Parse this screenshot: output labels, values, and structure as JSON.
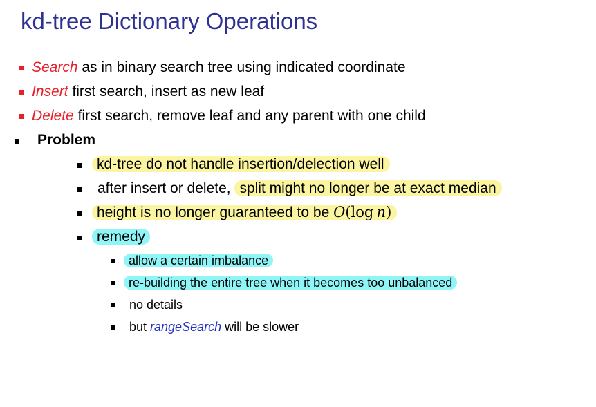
{
  "slide": {
    "title": "kd-tree Dictionary Operations",
    "ops": [
      {
        "keyword": "Search",
        "text": " as in binary search tree using indicated  coordinate"
      },
      {
        "keyword": "Insert",
        "text": " first search, insert as new leaf"
      },
      {
        "keyword": "Delete",
        "text": " first search, remove leaf and  any parent with one child"
      }
    ],
    "problem": {
      "label": "Problem",
      "items": {
        "i1": "kd-tree do not handle insertion/delection well",
        "i2_plain": "after insert or delete, ",
        "i2_highlight": "split might no longer be at exact  median",
        "i3_text": "height is no longer guaranteed to be ",
        "i3_math_o": "O",
        "i3_math_open": "(",
        "i3_math_log": "log",
        "i3_math_n": "n",
        "i3_math_close": ")",
        "i4": "remedy"
      },
      "remedy_items": {
        "r1": "allow a certain imbalance",
        "r2": "re-building the entire tree when it becomes too unbalanced",
        "r3": "no details",
        "r4_prefix": "but ",
        "r4_keyword": "rangeSearch",
        "r4_suffix": " will be slower"
      }
    },
    "colors": {
      "title": "#2e3192",
      "keyword_red": "#e8202a",
      "keyword_blue": "#1f2fc4",
      "highlight_yellow": "#fbf5a1",
      "highlight_cyan": "#8ff5f7"
    }
  }
}
